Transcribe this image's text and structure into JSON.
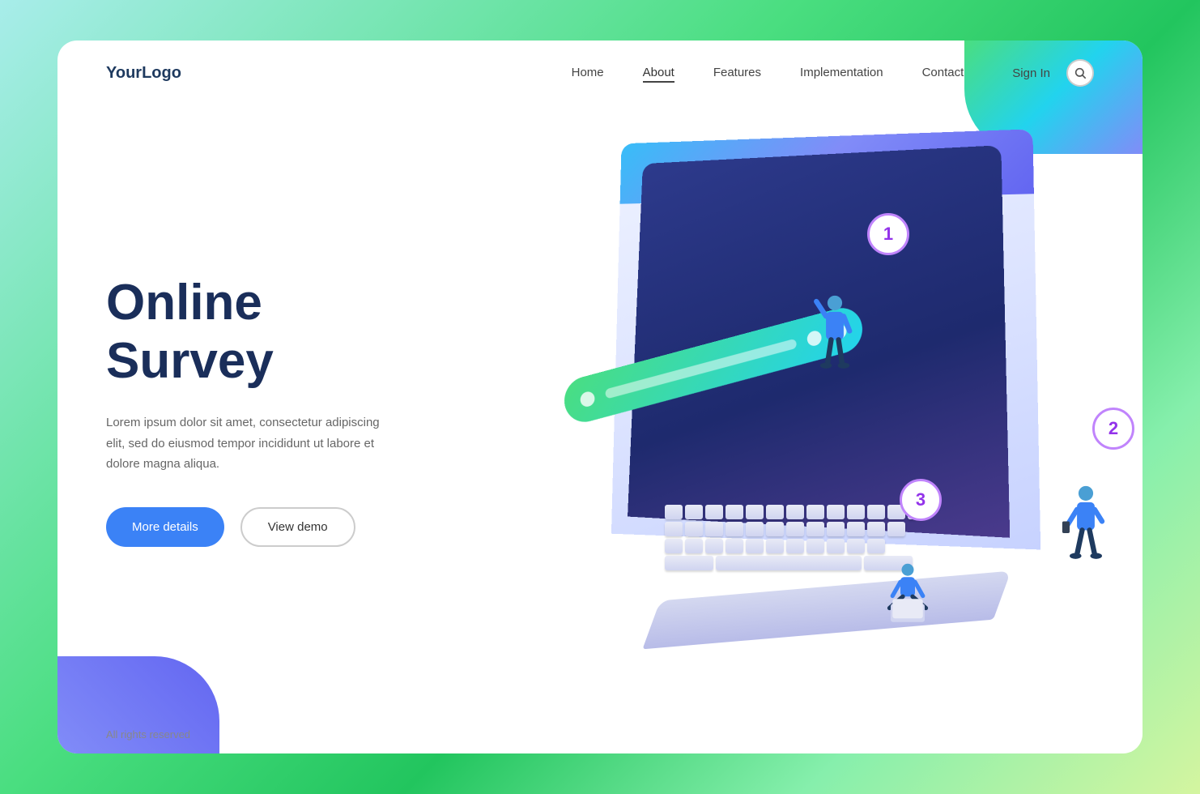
{
  "brand": {
    "logo": "YourLogo"
  },
  "nav": {
    "links": [
      {
        "label": "Home",
        "active": false
      },
      {
        "label": "About",
        "active": true
      },
      {
        "label": "Features",
        "active": false
      },
      {
        "label": "Implementation",
        "active": false
      },
      {
        "label": "Contact",
        "active": false
      }
    ],
    "signin": "Sign In",
    "search_icon": "🔍"
  },
  "hero": {
    "title": "Online Survey",
    "description": "Lorem ipsum dolor sit amet, consectetur adipiscing elit, sed do eiusmod tempor incididunt ut labore et dolore magna aliqua.",
    "btn_primary": "More details",
    "btn_outline": "View demo"
  },
  "checklist": {
    "items": [
      {
        "state": "checked",
        "symbol": "✓"
      },
      {
        "state": "cross",
        "symbol": "✕"
      },
      {
        "state": "checked",
        "symbol": "✓"
      }
    ]
  },
  "number_labels": [
    "1",
    "2",
    "3"
  ],
  "footer": {
    "text": "All rights reserved"
  }
}
